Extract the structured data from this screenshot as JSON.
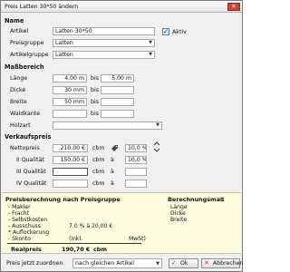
{
  "window": {
    "title": "Preis Latten 30*50 ändern",
    "close_glyph": "✕"
  },
  "name_section": {
    "header": "Name",
    "artikel_label": "Artikel",
    "artikel_value": "Latten 30*50",
    "aktiv_label": "Aktiv",
    "aktiv_checked": true,
    "preisgruppe_label": "Preisgruppe",
    "preisgruppe_value": "Latten",
    "artikelgruppe_label": "Artikelgruppe",
    "artikelgruppe_value": "Latten"
  },
  "mass_section": {
    "header": "Maßbereich",
    "rows": [
      {
        "label": "Länge",
        "from": "4,00 m",
        "bis": "bis",
        "to": "5,00 m"
      },
      {
        "label": "Dicke",
        "from": "30 mm",
        "bis": "bis",
        "to": ""
      },
      {
        "label": "Breite",
        "from": "50 mm",
        "bis": "bis",
        "to": ""
      },
      {
        "label": "Waldkante",
        "from": "",
        "bis": "bis",
        "to": ""
      }
    ],
    "holzart_label": "Holzart",
    "holzart_value": ""
  },
  "vk_section": {
    "header": "Verkaufspreis",
    "netto_label": "Nettopreis",
    "netto_value": "210,00 €",
    "netto_unit": "cbm",
    "netto_pct": "10,0 %",
    "q2_label": "II Qualität",
    "q2_value": "150,00 €",
    "q2_unit": "cbm",
    "q2_a": "à",
    "q2_pct": "10,0 %",
    "q3_label": "III Qualität",
    "q3_unit": "cbm",
    "q3_a": "à",
    "q4_label": "IV Qualität",
    "q4_unit": "cbm",
    "q4_a": "à"
  },
  "info": {
    "left_header": "Preisberechnung nach Preisgruppe",
    "right_header": "Berechnungsmaß",
    "items": [
      "- Makler",
      "- Fracht",
      "- Selbstkosten",
      "- Ausschuss",
      "* Auflockerung",
      "- Skonto"
    ],
    "ausschuss_value": "7.0 % à 20,00 €",
    "skonto_inkl": "(inkl.",
    "skonto_mwst": "MwSt)",
    "mass_items": [
      "Länge",
      "Dicke",
      "Breite"
    ],
    "realpreis_label": "Realpreis",
    "realpreis_value": "190,70 €",
    "realpreis_unit": "cbm"
  },
  "footer": {
    "zuordnen_label": "Preis jetzt zuordnen",
    "zuordnen_value": "nach gleichen Artikel",
    "ok_label": "Ok",
    "cancel_label": "Abbrechen"
  },
  "colors": {
    "info_bg": "#fffde0",
    "ok_check": "#2e8b2e",
    "cancel_x": "#c0392b"
  }
}
